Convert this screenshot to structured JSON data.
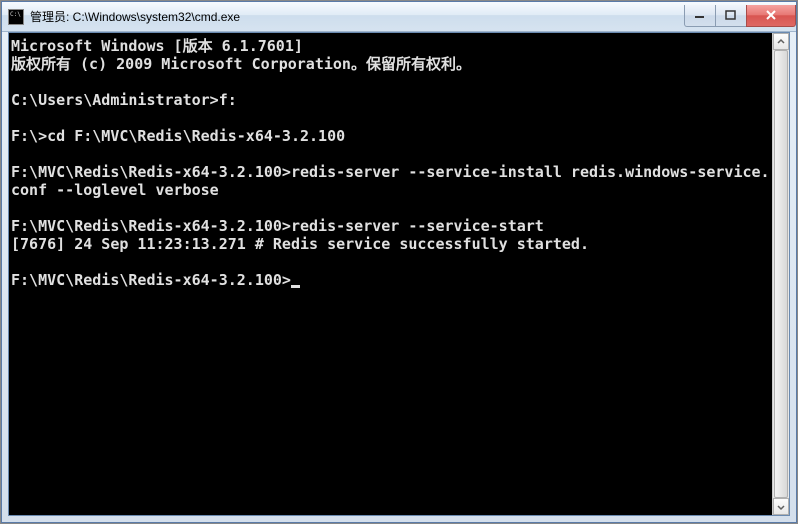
{
  "window": {
    "title": "管理员: C:\\Windows\\system32\\cmd.exe"
  },
  "terminal": {
    "lines": [
      "Microsoft Windows [版本 6.1.7601]",
      "版权所有 (c) 2009 Microsoft Corporation。保留所有权利。",
      "",
      "C:\\Users\\Administrator>f:",
      "",
      "F:\\>cd F:\\MVC\\Redis\\Redis-x64-3.2.100",
      "",
      "F:\\MVC\\Redis\\Redis-x64-3.2.100>redis-server --service-install redis.windows-service.conf --loglevel verbose",
      "",
      "F:\\MVC\\Redis\\Redis-x64-3.2.100>redis-server --service-start",
      "[7676] 24 Sep 11:23:13.271 # Redis service successfully started.",
      ""
    ],
    "current_prompt": "F:\\MVC\\Redis\\Redis-x64-3.2.100>"
  }
}
